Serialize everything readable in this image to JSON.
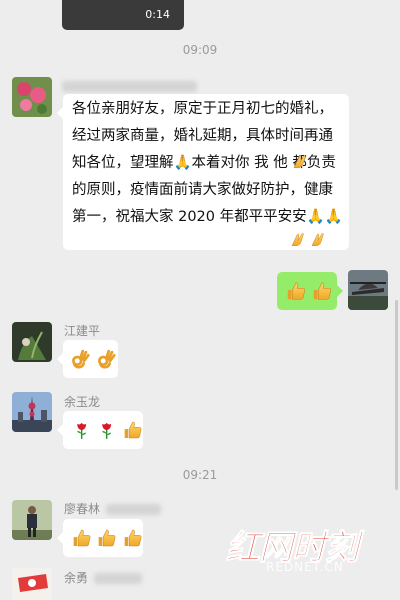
{
  "top_video": {
    "duration": "0:14"
  },
  "timestamps": [
    "09:09",
    "09:21"
  ],
  "messages": [
    {
      "sender": "",
      "text": "各位亲朋好友，原定于正月初七的婚礼，经过两家商量，婚礼延期，具体时间再通知各位，望理解🙏本着对你 我 他 都负责的原则，疫情面前请大家做好防护，健康第一，祝福大家 2020 年都平平安安🙏🙏"
    },
    {
      "sender": "me",
      "emojis": [
        "thumbs-up",
        "thumbs-up"
      ]
    },
    {
      "sender": "江建平",
      "emojis": [
        "ok-hand",
        "ok-hand"
      ]
    },
    {
      "sender": "余玉龙",
      "emojis": [
        "rose",
        "rose",
        "thumbs-up"
      ]
    },
    {
      "sender": "廖春林",
      "emojis": [
        "thumbs-up",
        "thumbs-up",
        "thumbs-up"
      ]
    },
    {
      "sender": "余勇"
    }
  ],
  "watermark": {
    "brand": "红网时刻",
    "url": "REDNET.CN"
  },
  "colors": {
    "background": "#ededed",
    "own_bubble": "#95ec69",
    "watermark": "#d9281c"
  }
}
